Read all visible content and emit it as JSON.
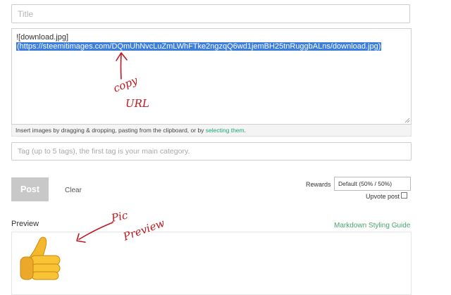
{
  "title": {
    "placeholder": "Title"
  },
  "editor": {
    "line1": "![download.jpg]",
    "line2": "(https://steemitimages.com/DQmUhNvcLuZmLWhFTke2ngzqQ6wd1jemBH25tnRuggbALns/download.jpg)"
  },
  "hint": {
    "text": "Insert images by dragging & dropping, pasting from the clipboard, or by ",
    "link": "selecting them",
    "suffix": "."
  },
  "tags": {
    "placeholder": "Tag (up to 5 tags), the first tag is your main category."
  },
  "actions": {
    "post": "Post",
    "clear": "Clear"
  },
  "rewards": {
    "label": "Rewards",
    "selected": "Default (50% / 50%)"
  },
  "upvote": {
    "label": "Upvote post"
  },
  "preview": {
    "label": "Preview",
    "guide": "Markdown Styling Guide"
  },
  "annotations": {
    "copy_note": [
      "copy",
      "URL"
    ],
    "pic_note": [
      "Pic",
      "Preview"
    ],
    "ink_color": "#c0161e"
  },
  "colors": {
    "accent": "#1fa67a",
    "selection": "#3b7ee0"
  }
}
